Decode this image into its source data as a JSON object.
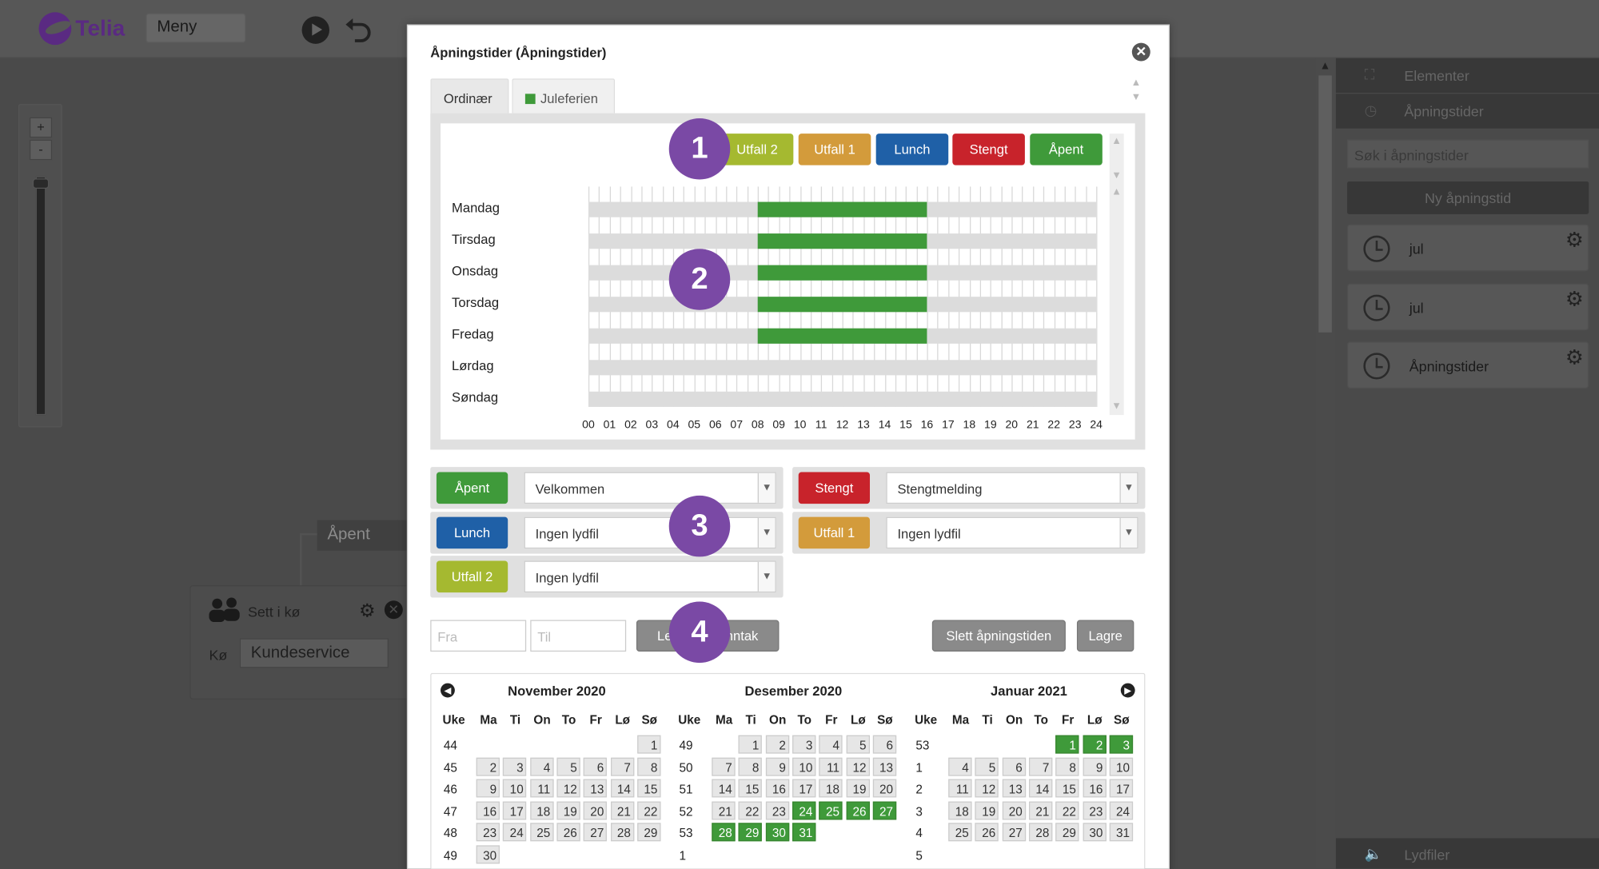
{
  "app": {
    "logo": "Telia",
    "menu": "Meny"
  },
  "canvas": {
    "zoom_in": "+",
    "zoom_out": "-",
    "node_apent": "Åpent",
    "queue_node": {
      "title": "Sett i kø",
      "queue_label": "Kø",
      "queue_value": "Kundeservice"
    }
  },
  "sidebar": {
    "elements": "Elementer",
    "opening_hours": "Åpningstider",
    "search_placeholder": "Søk i åpningstider",
    "new_button": "Ny åpningstid",
    "items": [
      {
        "label": "jul"
      },
      {
        "label": "jul"
      },
      {
        "label": "Åpningstider"
      }
    ],
    "sound_files": "Lydfiler"
  },
  "modal": {
    "title": "Åpningstider (Åpningstider)",
    "tabs": [
      {
        "label": "Ordinær"
      },
      {
        "label": "Juleferien"
      }
    ],
    "legend": [
      {
        "label": "Utfall 2",
        "color": "#a5b930"
      },
      {
        "label": "Utfall 1",
        "color": "#d39b3b"
      },
      {
        "label": "Lunch",
        "color": "#1f60a7"
      },
      {
        "label": "Stengt",
        "color": "#c8232b"
      },
      {
        "label": "Åpent",
        "color": "#3f9a3a"
      }
    ],
    "days": [
      "Mandag",
      "Tirsdag",
      "Onsdag",
      "Torsdag",
      "Fredag",
      "Lørdag",
      "Søndag"
    ],
    "hours": [
      "00",
      "01",
      "02",
      "03",
      "04",
      "05",
      "06",
      "07",
      "08",
      "09",
      "10",
      "11",
      "12",
      "13",
      "14",
      "15",
      "16",
      "17",
      "18",
      "19",
      "20",
      "21",
      "22",
      "23",
      "24"
    ],
    "schedule_open": [
      {
        "day": "Mandag",
        "from": "08",
        "to": "16"
      },
      {
        "day": "Tirsdag",
        "from": "08",
        "to": "16"
      },
      {
        "day": "Onsdag",
        "from": "08",
        "to": "16"
      },
      {
        "day": "Torsdag",
        "from": "08",
        "to": "16"
      },
      {
        "day": "Fredag",
        "from": "08",
        "to": "16"
      }
    ],
    "outcomes": [
      {
        "label": "Åpent",
        "value": "Velkommen"
      },
      {
        "label": "Stengt",
        "value": "Stengtmelding"
      },
      {
        "label": "Lunch",
        "value": "Ingen lydfil"
      },
      {
        "label": "Utfall 1",
        "value": "Ingen lydfil"
      },
      {
        "label": "Utfall 2",
        "value": "Ingen lydfil"
      }
    ],
    "from_placeholder": "Fra",
    "to_placeholder": "Til",
    "add_exception": "Legg til et unntak",
    "delete_button": "Slett åpningstiden",
    "save_button": "Lagre",
    "markers": [
      "1",
      "2",
      "3",
      "4"
    ],
    "calendar": {
      "headers": [
        "Uke",
        "Ma",
        "Ti",
        "On",
        "To",
        "Fr",
        "Lø",
        "Sø"
      ],
      "months": [
        {
          "name": "November 2020",
          "weeks": [
            "44",
            "45",
            "46",
            "47",
            "48",
            "49"
          ],
          "first_weekday": 7,
          "days": 30,
          "highlight": []
        },
        {
          "name": "Desember 2020",
          "weeks": [
            "49",
            "50",
            "51",
            "52",
            "53",
            "1"
          ],
          "first_weekday": 2,
          "days": 31,
          "highlight": [
            24,
            25,
            26,
            27,
            28,
            29,
            30,
            31
          ]
        },
        {
          "name": "Januar 2021",
          "weeks": [
            "53",
            "1",
            "2",
            "3",
            "4",
            "5"
          ],
          "first_weekday": 5,
          "days": 31,
          "highlight": [
            1,
            2,
            3
          ]
        }
      ]
    }
  }
}
